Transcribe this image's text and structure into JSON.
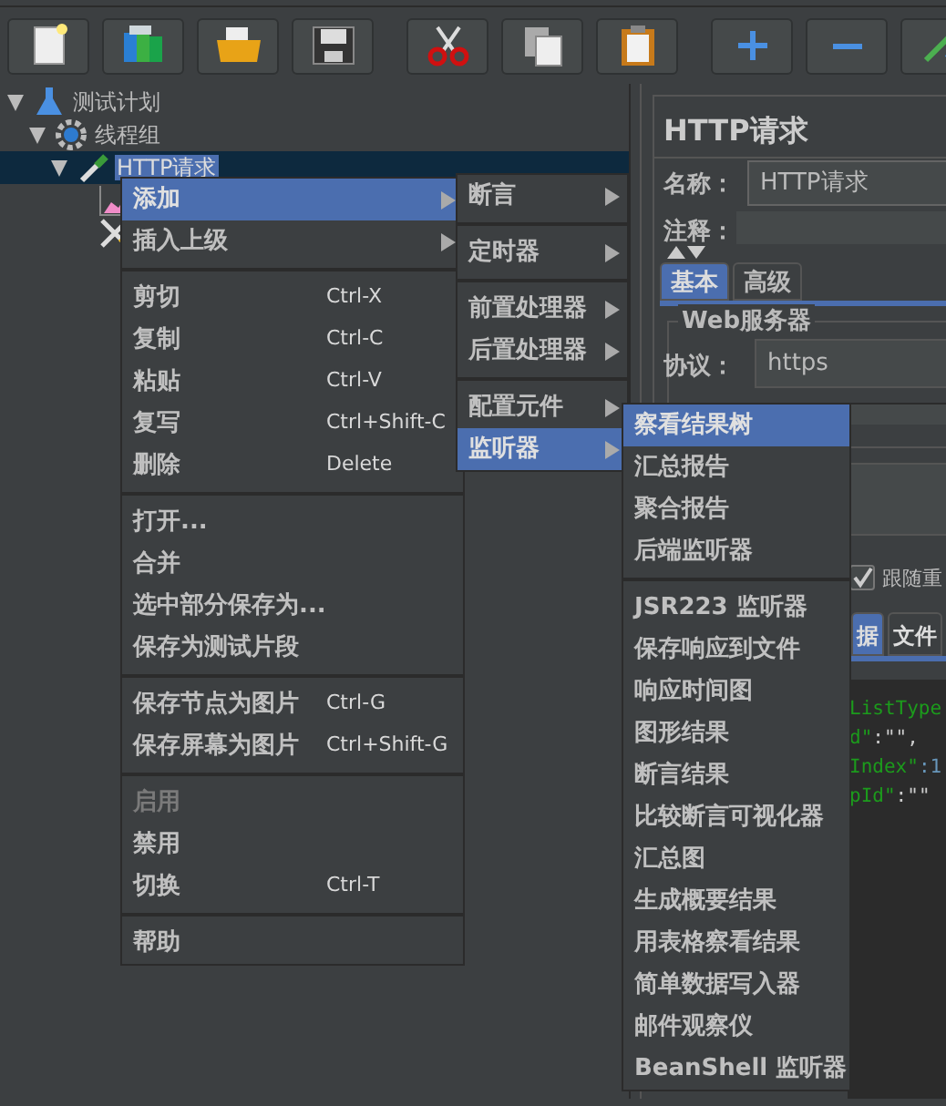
{
  "toolbar": [
    {
      "kind": "new"
    },
    {
      "kind": "templates"
    },
    {
      "kind": "open"
    },
    {
      "kind": "save"
    },
    {
      "kind": "cut"
    },
    {
      "kind": "copy"
    },
    {
      "kind": "paste"
    },
    {
      "kind": "expand"
    },
    {
      "kind": "collapse"
    },
    {
      "kind": "toggle"
    }
  ],
  "tree": [
    {
      "label": "测试计划",
      "kind": "plan",
      "expanded": true,
      "selected": false,
      "children": [
        {
          "label": "线程组",
          "kind": "group",
          "expanded": true,
          "selected": false,
          "children": [
            {
              "label": "HTTP请求",
              "kind": "sampler",
              "expanded": true,
              "selected": true,
              "children": [
                {
                  "kind": "chart"
                },
                {
                  "kind": "tools"
                }
              ]
            }
          ]
        }
      ]
    }
  ],
  "panel": {
    "title": "HTTP请求",
    "name_label": "名称：",
    "name_value": "HTTP请求",
    "comment_label": "注释：",
    "tabs": [
      {
        "label": "基本",
        "selected": true
      },
      {
        "label": "高级",
        "selected": false
      }
    ],
    "group_title": "Web服务器",
    "protocol_label": "协议：",
    "protocol_value": "https",
    "follow_redirects": {
      "label": "跟随重",
      "checked": true
    },
    "body_tabs": [
      {
        "label": "据",
        "selected": true
      },
      {
        "label": "文件",
        "selected": false
      }
    ],
    "code_lines": [
      {
        "parts": [
          {
            "text": "ListType",
            "kind": "string"
          }
        ]
      },
      {
        "parts": [
          {
            "text": "d\"",
            "kind": "string"
          },
          {
            "text": ":\"\",",
            "kind": "plain"
          }
        ]
      },
      {
        "parts": [
          {
            "text": "Index\"",
            "kind": "string"
          },
          {
            "text": ":1",
            "kind": "number"
          }
        ]
      },
      {
        "parts": [
          {
            "text": "pId\"",
            "kind": "string"
          },
          {
            "text": ":\"\"",
            "kind": "plain"
          }
        ]
      }
    ]
  },
  "context_menu": [
    {
      "kind": "submenu",
      "label": "添加",
      "selected": true
    },
    {
      "kind": "submenu",
      "label": "插入上级",
      "selected": false
    },
    {
      "kind": "separator"
    },
    {
      "kind": "item",
      "label": "剪切",
      "shortcut": "Ctrl-X",
      "disabled": false
    },
    {
      "kind": "item",
      "label": "复制",
      "shortcut": "Ctrl-C",
      "disabled": false
    },
    {
      "kind": "item",
      "label": "粘贴",
      "shortcut": "Ctrl-V",
      "disabled": false
    },
    {
      "kind": "item",
      "label": "复写",
      "shortcut": "Ctrl+Shift-C",
      "disabled": false
    },
    {
      "kind": "item",
      "label": "删除",
      "shortcut": "Delete",
      "disabled": false
    },
    {
      "kind": "separator"
    },
    {
      "kind": "item",
      "label": "打开...",
      "disabled": false
    },
    {
      "kind": "item",
      "label": "合并",
      "disabled": false
    },
    {
      "kind": "item",
      "label": "选中部分保存为...",
      "disabled": false
    },
    {
      "kind": "item",
      "label": "保存为测试片段",
      "disabled": false
    },
    {
      "kind": "separator"
    },
    {
      "kind": "item",
      "label": "保存节点为图片",
      "shortcut": "Ctrl-G",
      "disabled": false
    },
    {
      "kind": "item",
      "label": "保存屏幕为图片",
      "shortcut": "Ctrl+Shift-G",
      "disabled": false
    },
    {
      "kind": "separator"
    },
    {
      "kind": "item",
      "label": "启用",
      "disabled": true
    },
    {
      "kind": "item",
      "label": "禁用",
      "disabled": false
    },
    {
      "kind": "item",
      "label": "切换",
      "shortcut": "Ctrl-T",
      "disabled": false
    },
    {
      "kind": "separator"
    },
    {
      "kind": "item",
      "label": "帮助",
      "disabled": false
    }
  ],
  "add_menu": [
    {
      "kind": "submenu",
      "label": "断言",
      "selected": false
    },
    {
      "kind": "separator"
    },
    {
      "kind": "submenu",
      "label": "定时器",
      "selected": false
    },
    {
      "kind": "separator"
    },
    {
      "kind": "submenu",
      "label": "前置处理器",
      "selected": false
    },
    {
      "kind": "submenu",
      "label": "后置处理器",
      "selected": false
    },
    {
      "kind": "separator"
    },
    {
      "kind": "submenu",
      "label": "配置元件",
      "selected": false
    },
    {
      "kind": "submenu",
      "label": "监听器",
      "selected": true
    }
  ],
  "listener_menu": [
    {
      "kind": "item",
      "label": "察看结果树",
      "selected": true
    },
    {
      "kind": "item",
      "label": "汇总报告",
      "selected": false
    },
    {
      "kind": "item",
      "label": "聚合报告",
      "selected": false
    },
    {
      "kind": "item",
      "label": "后端监听器",
      "selected": false
    },
    {
      "kind": "separator"
    },
    {
      "kind": "item",
      "label": "JSR223 监听器",
      "selected": false
    },
    {
      "kind": "item",
      "label": "保存响应到文件",
      "selected": false
    },
    {
      "kind": "item",
      "label": "响应时间图",
      "selected": false
    },
    {
      "kind": "item",
      "label": "图形结果",
      "selected": false
    },
    {
      "kind": "item",
      "label": "断言结果",
      "selected": false
    },
    {
      "kind": "item",
      "label": "比较断言可视化器",
      "selected": false
    },
    {
      "kind": "item",
      "label": "汇总图",
      "selected": false
    },
    {
      "kind": "item",
      "label": "生成概要结果",
      "selected": false
    },
    {
      "kind": "item",
      "label": "用表格察看结果",
      "selected": false
    },
    {
      "kind": "item",
      "label": "简单数据写入器",
      "selected": false
    },
    {
      "kind": "item",
      "label": "邮件观察仪",
      "selected": false
    },
    {
      "kind": "item",
      "label": "BeanShell 监听器",
      "selected": false
    }
  ]
}
